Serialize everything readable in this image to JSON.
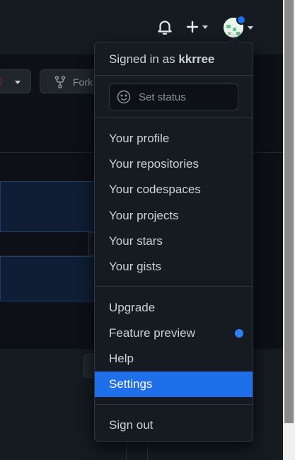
{
  "menu": {
    "signed_in_prefix": "Signed in as",
    "username": "kkrree",
    "status_placeholder": "Set status",
    "profile_items": [
      "Your profile",
      "Your repositories",
      "Your codespaces",
      "Your projects",
      "Your stars",
      "Your gists"
    ],
    "extra_items": [
      "Upgrade",
      "Feature preview",
      "Help",
      "Settings"
    ],
    "active_item": "Settings",
    "sign_out": "Sign out"
  },
  "background": {
    "fork_label": "Fork"
  },
  "icons": {
    "bell": "bell-icon",
    "plus": "plus-icon",
    "fork": "repo-forked-icon",
    "smiley": "smiley-icon"
  },
  "colors": {
    "accent": "#1f6feb",
    "menu_bg": "#161b22",
    "border": "#30363d",
    "text": "#c9d1d9"
  }
}
